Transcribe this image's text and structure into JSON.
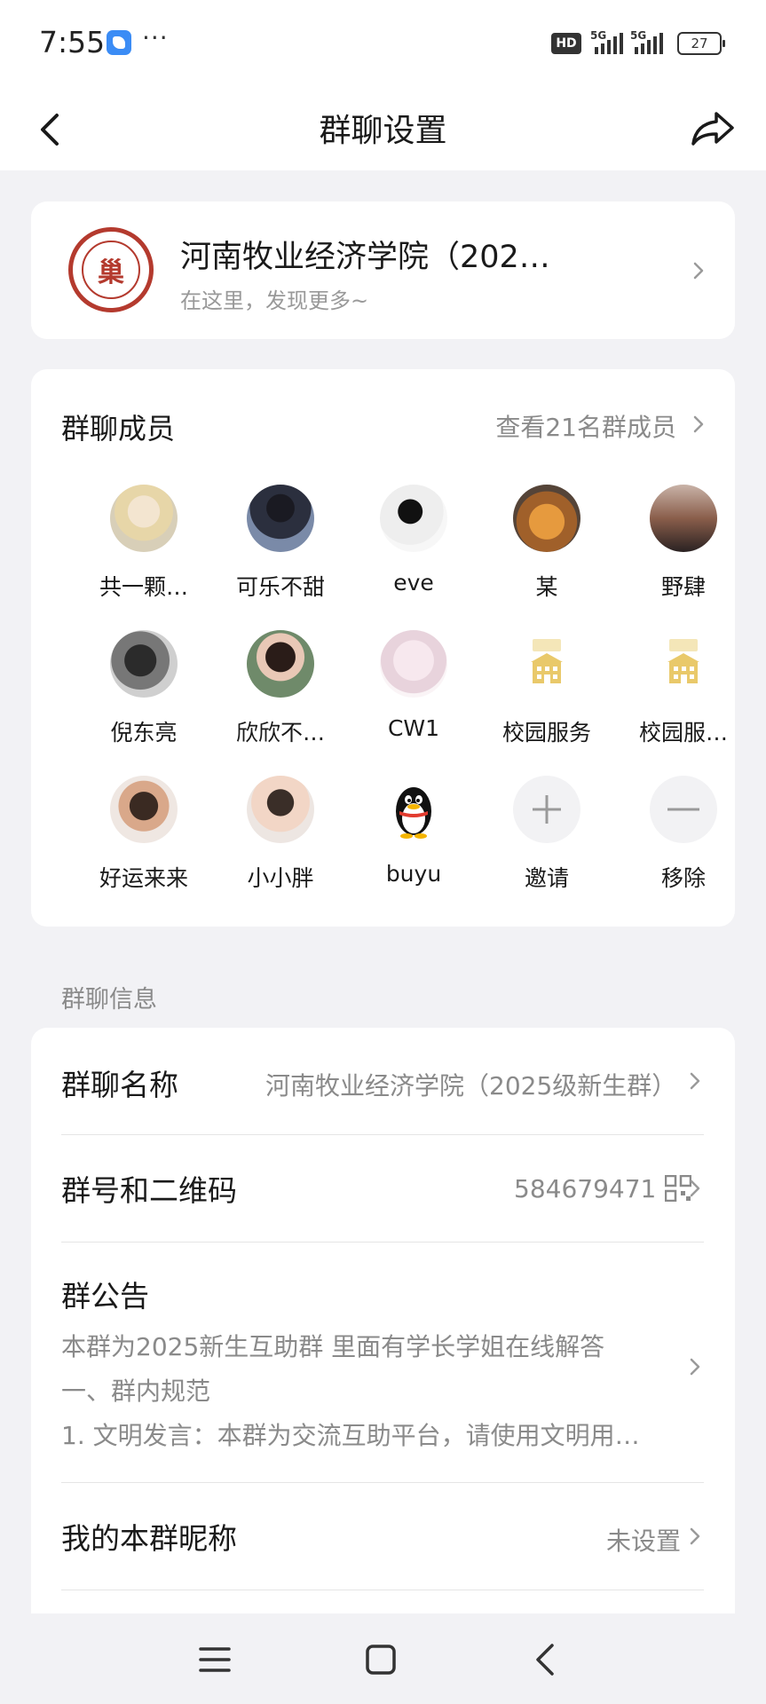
{
  "status_bar": {
    "time": "7:55",
    "more": "···",
    "hd": "HD",
    "net1": "5G",
    "net2": "5G",
    "battery": "27"
  },
  "nav": {
    "title": "群聊设置"
  },
  "group": {
    "name": "河南牧业经济学院（202…",
    "subtitle": "在这里，发现更多~",
    "logo_char": "巢"
  },
  "members": {
    "title": "群聊成员",
    "view_all": "查看21名群成员",
    "list": [
      {
        "name": "共一颗…"
      },
      {
        "name": "可乐不甜"
      },
      {
        "name": "eve"
      },
      {
        "name": "某"
      },
      {
        "name": "野肆"
      },
      {
        "name": "倪东亮"
      },
      {
        "name": "欣欣不…"
      },
      {
        "name": "CW1"
      },
      {
        "name": "校园服务"
      },
      {
        "name": "校园服…"
      },
      {
        "name": "好运来来"
      },
      {
        "name": "小小胖"
      },
      {
        "name": "buyu"
      },
      {
        "name": "邀请"
      },
      {
        "name": "移除"
      }
    ]
  },
  "info": {
    "section_label": "群聊信息",
    "group_name_label": "群聊名称",
    "group_name_value": "河南牧业经济学院（2025级新生群）",
    "group_id_label": "群号和二维码",
    "group_id_value": "584679471",
    "notice_label": "群公告",
    "notice_lines": [
      "本群为2025新生互助群  里面有学长学姐在线解答",
      "一、群内规范",
      "1. 文明发言：本群为交流互助平台，请使用文明用…"
    ],
    "nickname_label": "我的本群昵称",
    "nickname_value": "未设置"
  },
  "colors": {
    "background": "#f2f2f5",
    "card": "#ffffff",
    "secondary_text": "#8a8a8a",
    "logo_red": "#b43a2e"
  },
  "icons": [
    "back-icon",
    "share-icon",
    "chevron-right-icon",
    "qr-code-icon",
    "plus-icon",
    "minus-icon",
    "menu-icon",
    "home-square-icon",
    "back-triangle-icon"
  ]
}
